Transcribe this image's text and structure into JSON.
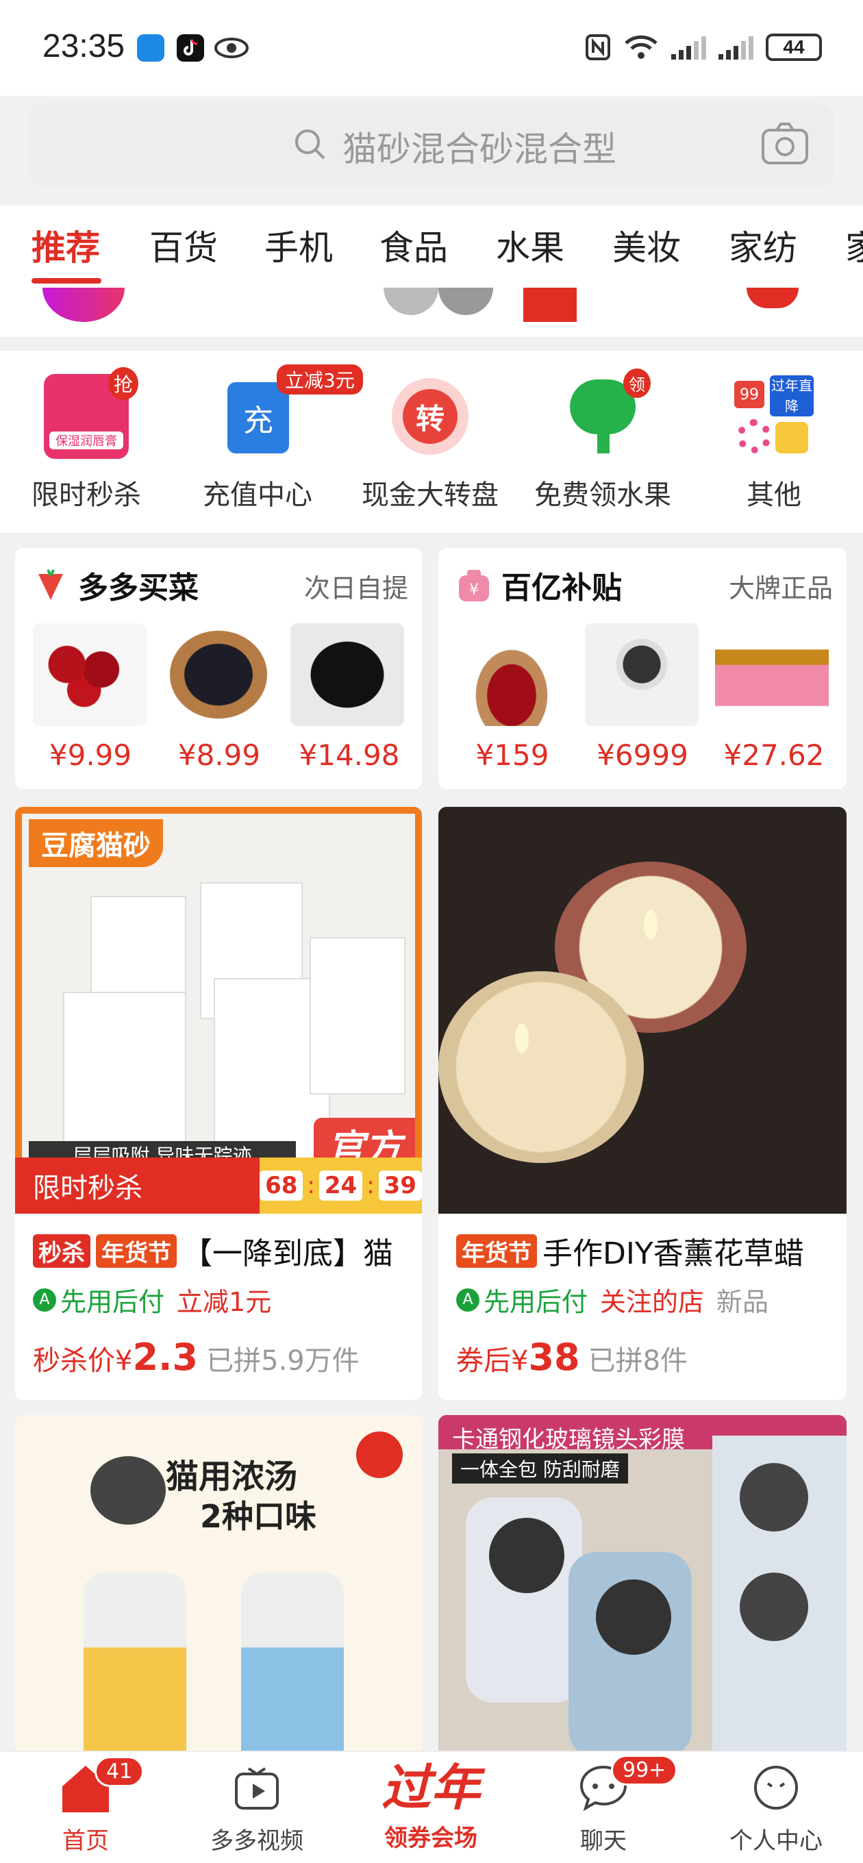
{
  "status_bar": {
    "time": "23:35",
    "battery": "44"
  },
  "search": {
    "placeholder": "猫砂混合砂混合型"
  },
  "tabs": [
    "推荐",
    "百货",
    "手机",
    "食品",
    "水果",
    "美妆",
    "家纺",
    "家"
  ],
  "quick_actions": [
    {
      "label": "限时秒杀",
      "badge": "抢",
      "icon_text": "保湿润唇膏"
    },
    {
      "label": "充值中心",
      "badge": "立减3元",
      "icon_text": "充"
    },
    {
      "label": "现金大转盘",
      "badge": "",
      "icon_text": "转"
    },
    {
      "label": "免费领水果",
      "badge": "领",
      "icon_text": ""
    },
    {
      "label": "其他",
      "badge": "",
      "icon_text": "过年直降"
    }
  ],
  "cards": [
    {
      "title": "多多买菜",
      "subtitle": "次日自提",
      "prices": [
        "¥9.99",
        "¥8.99",
        "¥14.98"
      ]
    },
    {
      "title": "百亿补贴",
      "subtitle": "大牌正品",
      "prices": [
        "¥159",
        "¥6999",
        "¥27.62"
      ]
    }
  ],
  "products": [
    {
      "image_text_top": "豆腐猫砂",
      "image_text_bottom": "层层吸附 异味无踪迹",
      "image_badge": "官方",
      "flash_label": "限时秒杀",
      "countdown": [
        "68",
        "24",
        "39"
      ],
      "tags": [
        "秒杀",
        "年货节"
      ],
      "title": "【一降到底】猫",
      "green_label": "先用后付",
      "red_label": "立减1元",
      "grey_label": "",
      "price_prefix": "秒杀价¥",
      "price": "2.3",
      "sold": "已拼5.9万件"
    },
    {
      "tags": [
        "年货节"
      ],
      "title": "手作DIY香薰花草蜡",
      "green_label": "先用后付",
      "red_label": "关注的店",
      "grey_label": "新品",
      "price_prefix": "券后¥",
      "price": "38",
      "sold": "已拼8件"
    },
    {
      "image_text_top": "猫用浓汤",
      "image_text_sub": "2种口味"
    },
    {
      "image_text_top": "卡通钢化玻璃镜头彩膜",
      "image_text_sub": "一体全包 防刮耐磨"
    }
  ],
  "bottom_nav": [
    {
      "label": "首页",
      "badge": "41"
    },
    {
      "label": "多多视频",
      "badge": ""
    },
    {
      "label": "领券会场",
      "badge": "",
      "logo_text": "过年"
    },
    {
      "label": "聊天",
      "badge": "99+"
    },
    {
      "label": "个人中心",
      "badge": ""
    }
  ],
  "colors": {
    "accent": "#e02e24",
    "green": "#1aa23a",
    "background": "#f1f1f1"
  }
}
